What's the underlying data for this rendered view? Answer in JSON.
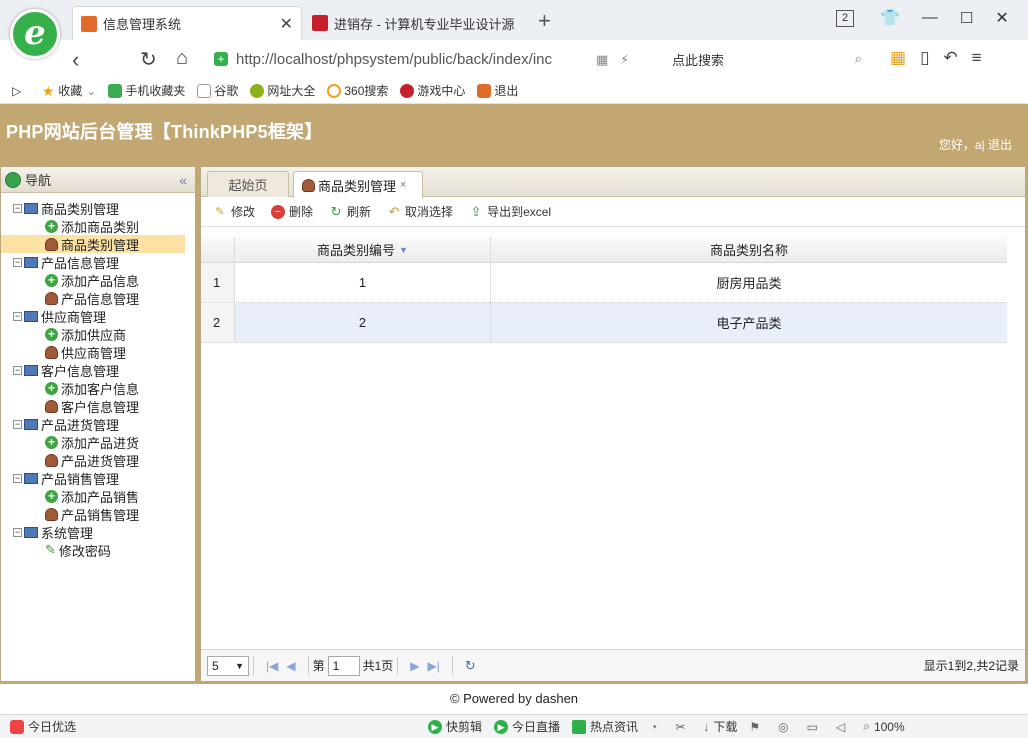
{
  "browser": {
    "tabs": [
      {
        "title": "信息管理系统",
        "active": true
      },
      {
        "title": "进销存 - 计算机专业毕业设计源",
        "active": false
      }
    ],
    "window_badge": "2",
    "url": "http://localhost/phpsystem/public/back/index/inc",
    "search_placeholder": "点此搜索",
    "bookmarks": [
      "收藏",
      "手机收藏夹",
      "谷歌",
      "网址大全",
      "360搜索",
      "游戏中心",
      "退出"
    ]
  },
  "header": {
    "title": "PHP网站后台管理【ThinkPHP5框架】",
    "greeting": "您好，a| 退出"
  },
  "sidebar": {
    "title": "导航",
    "groups": [
      {
        "label": "商品类别管理",
        "children": [
          {
            "label": "添加商品类别",
            "icon": "add-icon"
          },
          {
            "label": "商品类别管理",
            "icon": "user-icon",
            "selected": true
          }
        ]
      },
      {
        "label": "产品信息管理",
        "children": [
          {
            "label": "添加产品信息",
            "icon": "add-icon"
          },
          {
            "label": "产品信息管理",
            "icon": "user-icon"
          }
        ]
      },
      {
        "label": "供应商管理",
        "children": [
          {
            "label": "添加供应商",
            "icon": "add-icon"
          },
          {
            "label": "供应商管理",
            "icon": "user-icon"
          }
        ]
      },
      {
        "label": "客户信息管理",
        "children": [
          {
            "label": "添加客户信息",
            "icon": "add-icon"
          },
          {
            "label": "客户信息管理",
            "icon": "user-icon"
          }
        ]
      },
      {
        "label": "产品进货管理",
        "children": [
          {
            "label": "添加产品进货",
            "icon": "add-icon"
          },
          {
            "label": "产品进货管理",
            "icon": "user-icon"
          }
        ]
      },
      {
        "label": "产品销售管理",
        "children": [
          {
            "label": "添加产品销售",
            "icon": "add-icon"
          },
          {
            "label": "产品销售管理",
            "icon": "user-icon"
          }
        ]
      },
      {
        "label": "系统管理",
        "children": [
          {
            "label": "修改密码",
            "icon": "pencil-icon"
          }
        ]
      }
    ]
  },
  "main": {
    "tabs": [
      {
        "label": "起始页",
        "active": false
      },
      {
        "label": "商品类别管理",
        "active": true
      }
    ],
    "toolbar": {
      "edit": "修改",
      "delete": "删除",
      "refresh": "刷新",
      "cancel_select": "取消选择",
      "export": "导出到excel"
    },
    "grid": {
      "columns": [
        "商品类别编号",
        "商品类别名称"
      ],
      "rows": [
        {
          "rownum": "1",
          "id": "1",
          "name": "厨房用品类"
        },
        {
          "rownum": "2",
          "id": "2",
          "name": "电子产品类"
        }
      ]
    },
    "pager": {
      "page_size": "5",
      "page_prefix": "第",
      "page_value": "1",
      "page_suffix": "共1页",
      "info": "显示1到2,共2记录"
    }
  },
  "footer": {
    "text": "© Powered by dashen"
  },
  "statusbar": {
    "items": [
      "今日优选",
      "快剪辑",
      "今日直播",
      "热点资讯",
      "下载",
      "100%"
    ]
  },
  "colors": {
    "banner": "#c2a772",
    "selected_node": "#fbe2a4",
    "alt_row": "#e8eefa",
    "brand_green": "#35b04a"
  }
}
